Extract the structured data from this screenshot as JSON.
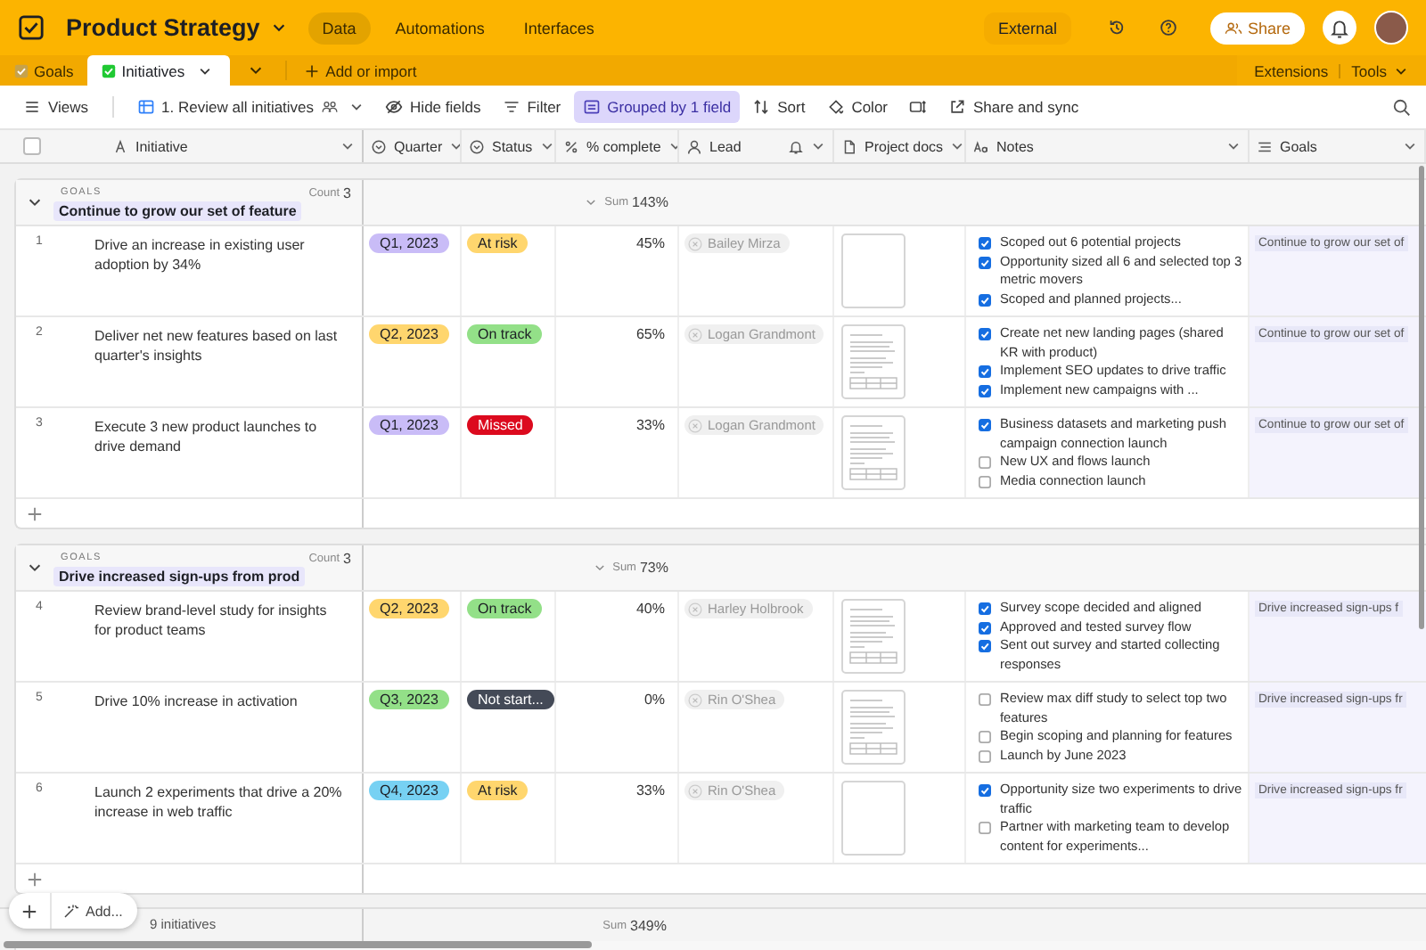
{
  "app": {
    "title": "Product Strategy",
    "nav": [
      {
        "label": "Data",
        "selected": true
      },
      {
        "label": "Automations",
        "selected": false
      },
      {
        "label": "Interfaces",
        "selected": false
      }
    ],
    "external": "External",
    "share": "Share"
  },
  "tabs": [
    {
      "label": "Goals",
      "selected": false
    },
    {
      "label": "Initiatives",
      "selected": true
    }
  ],
  "add_import": "Add or import",
  "extensions": "Extensions",
  "tools": "Tools",
  "toolbar": {
    "views": "Views",
    "view_name": "1. Review all initiatives",
    "items": [
      {
        "kind": "hide",
        "label": "Hide fields",
        "selected": false
      },
      {
        "kind": "filter",
        "label": "Filter",
        "selected": false
      },
      {
        "kind": "group",
        "label": "Grouped by 1 field",
        "selected": true
      },
      {
        "kind": "sort",
        "label": "Sort",
        "selected": false
      },
      {
        "kind": "color",
        "label": "Color",
        "selected": false
      },
      {
        "kind": "height",
        "selected": false
      },
      {
        "kind": "share",
        "label": "Share and sync",
        "selected": false
      }
    ]
  },
  "select_all": {
    "checked": false
  },
  "columns": [
    {
      "kind": "text",
      "label": "Initiative"
    },
    {
      "kind": "select",
      "label": "Quarter"
    },
    {
      "kind": "select",
      "label": "Status"
    },
    {
      "kind": "percent",
      "label": "% complete"
    },
    {
      "kind": "user",
      "label": "Lead"
    },
    {
      "kind": "file",
      "label": "Project docs"
    },
    {
      "kind": "notes",
      "label": "Notes"
    },
    {
      "kind": "link",
      "label": "Goals"
    }
  ],
  "groups": [
    {
      "heading": "GOALS",
      "title": "Continue to grow our set of feature",
      "count_label": "Count",
      "count": "3",
      "sum_label": "Sum",
      "sum": "143%",
      "rows": [
        {
          "number": "1",
          "initiative": "Drive an increase in existing user adoption by 34%",
          "quarter": {
            "label": "Q1, 2023",
            "color": "#c9bcf7"
          },
          "status": {
            "label": "At risk",
            "color": "#ffd66e"
          },
          "complete": "45%",
          "lead": "Bailey Mirza",
          "preview": false,
          "notes": [
            {
              "text": "Scoped out 6 potential projects",
              "checked": true
            },
            {
              "text": "Opportunity sized all 6 and selected top 3 metric movers",
              "checked": true
            },
            {
              "text": "Scoped and planned projects...",
              "checked": true
            }
          ],
          "goal": "Continue to grow our set of"
        },
        {
          "number": "2",
          "initiative": "Deliver net new features based on last quarter's insights",
          "quarter": {
            "label": "Q2, 2023",
            "color": "#ffd66e"
          },
          "status": {
            "label": "On track",
            "color": "#93e088"
          },
          "complete": "65%",
          "lead": "Logan Grandmont",
          "preview": true,
          "notes": [
            {
              "text": "Create net new landing pages (shared KR with product)",
              "checked": true
            },
            {
              "text": "Implement SEO updates to drive traffic",
              "checked": true
            },
            {
              "text": "Implement new campaigns with ...",
              "checked": true
            }
          ],
          "goal": "Continue to grow our set of"
        },
        {
          "number": "3",
          "initiative": "Execute 3 new product launches to drive demand",
          "quarter": {
            "label": "Q1, 2023",
            "color": "#c9bcf7"
          },
          "status": {
            "label": "Missed",
            "color": "#dc0a1e"
          },
          "complete": "33%",
          "lead": "Logan Grandmont",
          "preview": true,
          "notes": [
            {
              "text": "Business datasets and marketing push campaign connection launch",
              "checked": true
            },
            {
              "text": "New UX and flows launch",
              "checked": false
            },
            {
              "text": "Media connection launch",
              "checked": false
            }
          ],
          "goal": "Continue to grow our set of"
        }
      ]
    },
    {
      "heading": "GOALS",
      "title": "Drive increased sign-ups from prod",
      "count_label": "Count",
      "count": "3",
      "sum_label": "Sum",
      "sum": "73%",
      "rows": [
        {
          "number": "4",
          "initiative": "Review brand-level study for insights for product teams",
          "quarter": {
            "label": "Q2, 2023",
            "color": "#ffd66e"
          },
          "status": {
            "label": "On track",
            "color": "#93e088"
          },
          "complete": "40%",
          "lead": "Harley Holbrook",
          "preview": true,
          "notes": [
            {
              "text": "Survey scope decided and aligned",
              "checked": true
            },
            {
              "text": "Approved and tested survey flow",
              "checked": true
            },
            {
              "text": "Sent out survey and started collecting responses",
              "checked": true
            }
          ],
          "goal": "Drive increased sign-ups f"
        },
        {
          "number": "5",
          "initiative": "Drive 10% increase in activation",
          "quarter": {
            "label": "Q3, 2023",
            "color": "#93e088"
          },
          "status": {
            "label": "Not start...",
            "color": "#444a57"
          },
          "complete": "0%",
          "lead": "Rin O'Shea",
          "preview": true,
          "notes": [
            {
              "text": "Review max diff study to select top two features",
              "checked": false
            },
            {
              "text": "Begin scoping and planning for features",
              "checked": false
            },
            {
              "text": "Launch by June 2023",
              "checked": false
            }
          ],
          "goal": "Drive increased sign-ups fr"
        },
        {
          "number": "6",
          "initiative": "Launch 2 experiments that drive a 20% increase in web traffic",
          "quarter": {
            "label": "Q4, 2023",
            "color": "#77d1f3"
          },
          "status": {
            "label": "At risk",
            "color": "#ffd66e"
          },
          "complete": "33%",
          "lead": "Rin O'Shea",
          "preview": false,
          "notes": [
            {
              "text": "Opportunity size two experiments to drive traffic",
              "checked": true
            },
            {
              "text": "Partner with marketing team to develop content for experiments...",
              "checked": false
            }
          ],
          "goal": "Drive increased sign-ups fr"
        }
      ]
    }
  ],
  "footer": {
    "add": "Add...",
    "records": "9 initiatives",
    "sum_label": "Sum",
    "sum": "349%"
  }
}
